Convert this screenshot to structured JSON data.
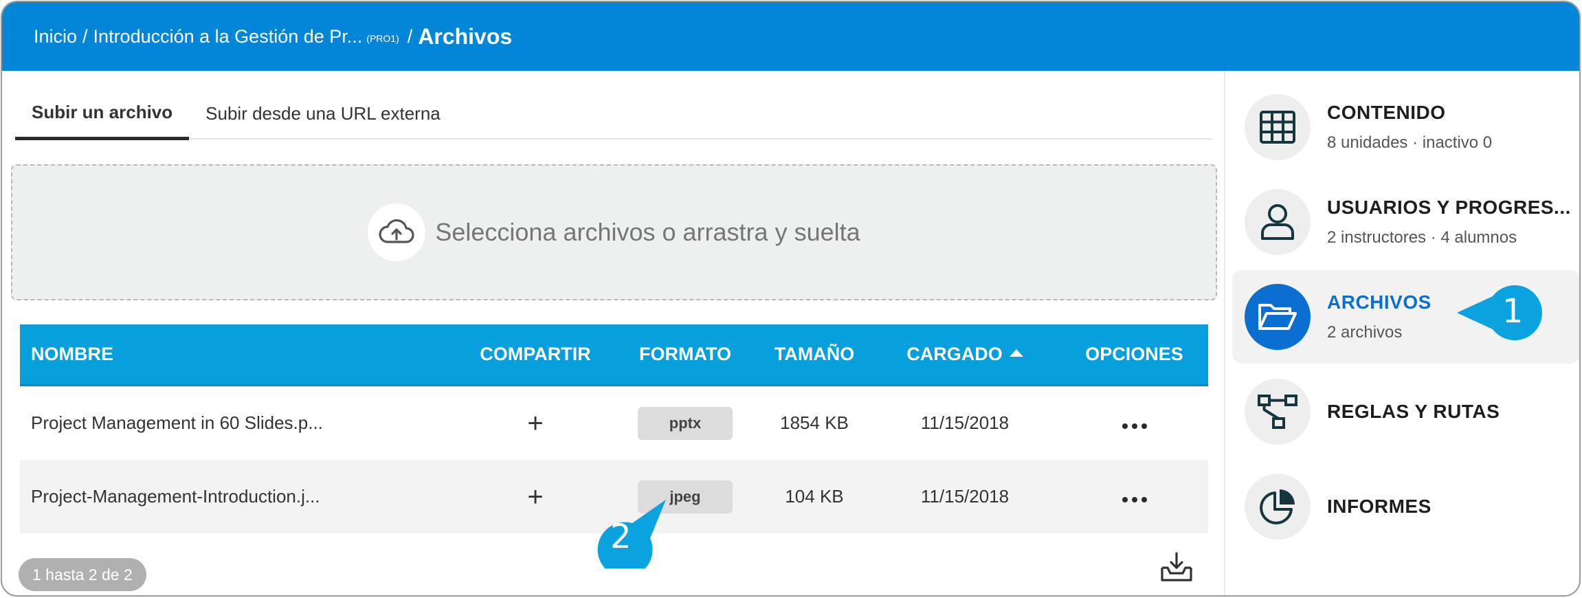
{
  "header": {
    "breadcrumb_home": "Inicio",
    "breadcrumb_sep": "/",
    "breadcrumb_course": "Introducción a la Gestión de Pr...",
    "breadcrumb_code": "(PRO1)",
    "breadcrumb_current": "Archivos",
    "color": "#0385d8"
  },
  "tabs": [
    {
      "label": "Subir un archivo",
      "active": true
    },
    {
      "label": "Subir desde una URL externa",
      "active": false
    }
  ],
  "dropzone": {
    "text": "Selecciona archivos o arrastra y suelta",
    "icon": "cloud-upload-icon"
  },
  "table": {
    "columns": [
      "NOMBRE",
      "COMPARTIR",
      "FORMATO",
      "TAMAÑO",
      "CARGADO",
      "OPCIONES"
    ],
    "header_color": "#069fdc",
    "rows": [
      {
        "name": "Project Management in 60 Slides.p...",
        "share": "+",
        "format": "pptx",
        "size": "1854 KB",
        "uploaded": "11/15/2018"
      },
      {
        "name": "Project-Management-Introduction.j...",
        "share": "+",
        "format": "jpeg",
        "size": "104 KB",
        "uploaded": "11/15/2018"
      }
    ]
  },
  "footer": {
    "pager": "1 hasta 2 de 2"
  },
  "sidebar": {
    "items": [
      {
        "title": "CONTENIDO",
        "sub": "8 unidades · inactivo 0",
        "icon": "grid-icon"
      },
      {
        "title": "USUARIOS Y PROGRES...",
        "sub": "2 instructores · 4 alumnos",
        "icon": "user-icon"
      },
      {
        "title": "ARCHIVOS",
        "sub": "2 archivos",
        "icon": "folder-open-icon",
        "active": true
      },
      {
        "title": "REGLAS Y RUTAS",
        "sub": "",
        "icon": "flow-icon"
      },
      {
        "title": "INFORMES",
        "sub": "",
        "icon": "pie-chart-icon"
      }
    ],
    "accent": "#0a6fd0"
  },
  "callouts": [
    {
      "number": "1",
      "color": "#0aa3e0"
    },
    {
      "number": "2",
      "color": "#0aa3e0"
    }
  ]
}
